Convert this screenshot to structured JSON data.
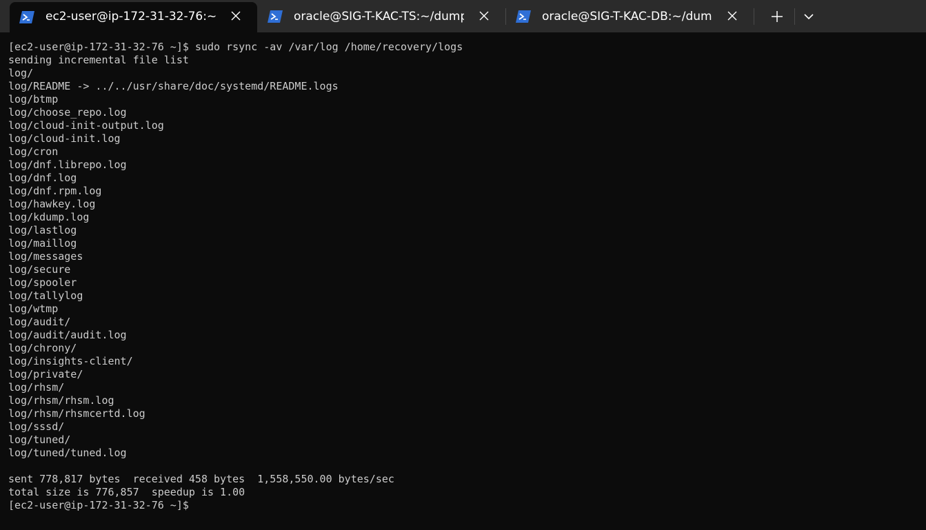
{
  "tabs": [
    {
      "title": "ec2-user@ip-172-31-32-76:~",
      "active": true,
      "icon": "powershell-icon"
    },
    {
      "title": "oracle@SIG-T-KAC-TS:~/dump",
      "active": false,
      "icon": "powershell-icon"
    },
    {
      "title": "oracle@SIG-T-KAC-DB:~/dump",
      "active": false,
      "icon": "powershell-icon"
    }
  ],
  "tabbar_icons": {
    "new_tab": "plus-icon",
    "dropdown": "chevron-down-icon",
    "close": "close-icon"
  },
  "colors": {
    "terminal_bg": "#0c0c0c",
    "tabbar_bg": "#2b2b2b",
    "text": "#cccccc",
    "icon_blue": "#2f6fd6"
  },
  "terminal": {
    "lines": [
      "[ec2-user@ip-172-31-32-76 ~]$ sudo rsync -av /var/log /home/recovery/logs",
      "sending incremental file list",
      "log/",
      "log/README -> ../../usr/share/doc/systemd/README.logs",
      "log/btmp",
      "log/choose_repo.log",
      "log/cloud-init-output.log",
      "log/cloud-init.log",
      "log/cron",
      "log/dnf.librepo.log",
      "log/dnf.log",
      "log/dnf.rpm.log",
      "log/hawkey.log",
      "log/kdump.log",
      "log/lastlog",
      "log/maillog",
      "log/messages",
      "log/secure",
      "log/spooler",
      "log/tallylog",
      "log/wtmp",
      "log/audit/",
      "log/audit/audit.log",
      "log/chrony/",
      "log/insights-client/",
      "log/private/",
      "log/rhsm/",
      "log/rhsm/rhsm.log",
      "log/rhsm/rhsmcertd.log",
      "log/sssd/",
      "log/tuned/",
      "log/tuned/tuned.log",
      "",
      "sent 778,817 bytes  received 458 bytes  1,558,550.00 bytes/sec",
      "total size is 776,857  speedup is 1.00",
      "[ec2-user@ip-172-31-32-76 ~]$"
    ]
  }
}
